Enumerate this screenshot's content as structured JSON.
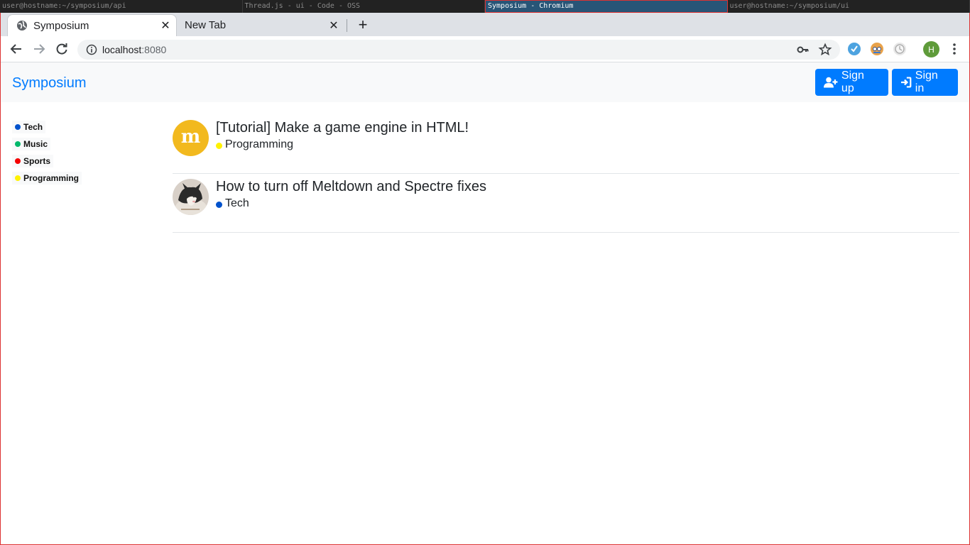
{
  "taskbar": {
    "items": [
      {
        "label": "user@hostname:~/symposium/api"
      },
      {
        "label": "Thread.js - ui - Code - OSS"
      },
      {
        "label": "Symposium - Chromium"
      },
      {
        "label": "user@hostname:~/symposium/ui"
      }
    ]
  },
  "browser": {
    "tabs": [
      {
        "title": "Symposium"
      },
      {
        "title": "New Tab"
      }
    ],
    "url_host": "localhost",
    "url_port": ":8080",
    "profile_initial": "H"
  },
  "site": {
    "brand": "Symposium",
    "signup_label": "Sign up",
    "signin_label": "Sign in",
    "brand_color": "#007bff"
  },
  "categories": [
    {
      "label": "Tech",
      "color": "#0052cc"
    },
    {
      "label": "Music",
      "color": "#00b86b"
    },
    {
      "label": "Sports",
      "color": "#f50000"
    },
    {
      "label": "Programming",
      "color": "#fff200"
    }
  ],
  "threads": [
    {
      "title": "[Tutorial] Make a game engine in HTML!",
      "category": "Programming",
      "category_color": "#fff200",
      "avatar": "m-logo",
      "avatar_letter": "m"
    },
    {
      "title": "How to turn off Meltdown and Spectre fixes",
      "category": "Tech",
      "category_color": "#0052cc",
      "avatar": "cat-photo"
    }
  ]
}
